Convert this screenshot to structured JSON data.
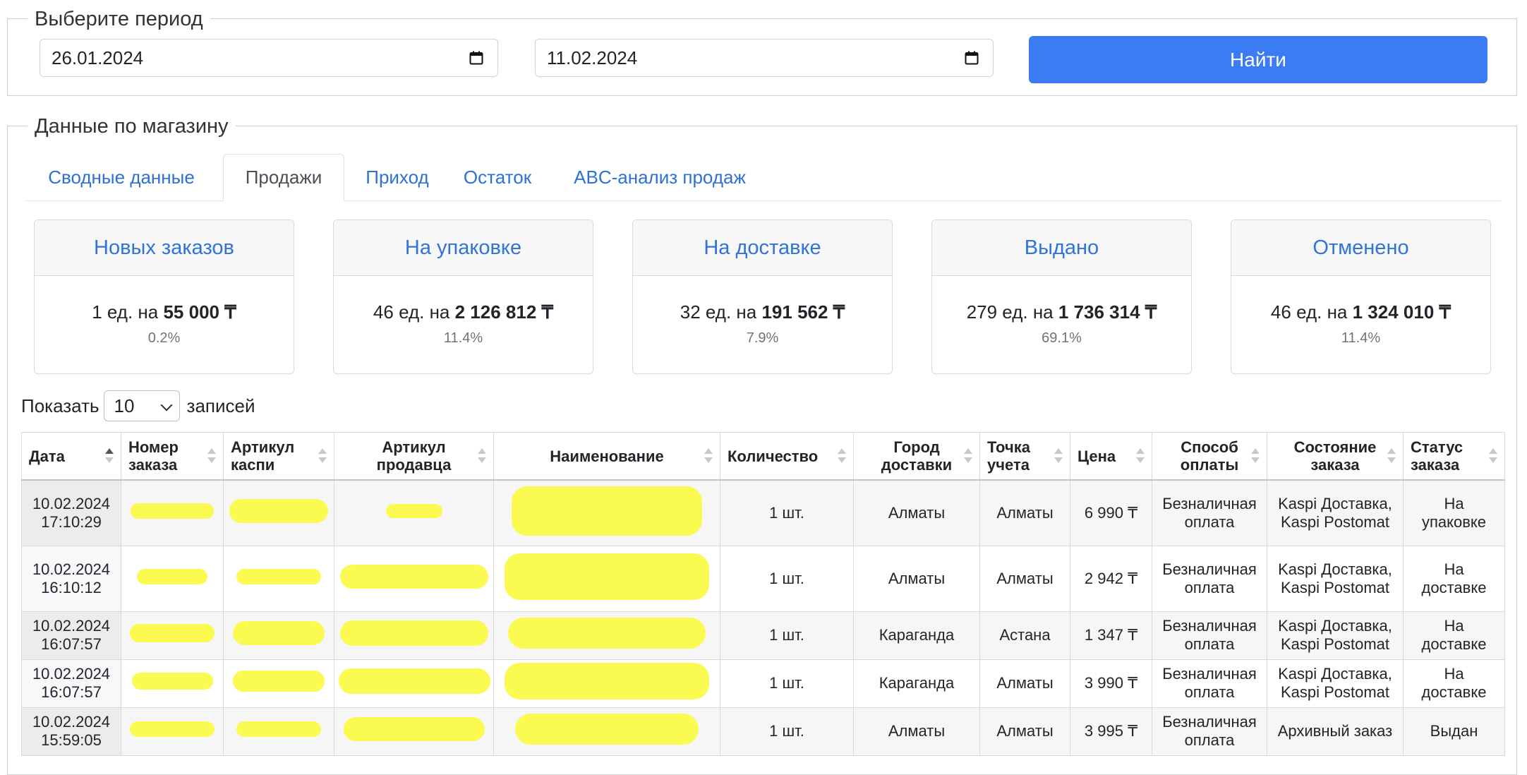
{
  "period": {
    "legend": "Выберите период",
    "date_from": "26.01.2024",
    "date_to": "11.02.2024",
    "find_label": "Найти"
  },
  "shop": {
    "legend": "Данные по магазину",
    "tabs": [
      {
        "label": "Сводные данные",
        "active": false
      },
      {
        "label": "Продажи",
        "active": true
      },
      {
        "label": "Приход",
        "active": false
      },
      {
        "label": "Остаток",
        "active": false
      },
      {
        "label": "ABC-анализ продаж",
        "active": false
      }
    ],
    "cards": [
      {
        "title": "Новых заказов",
        "qty": "1 ед. на ",
        "amount": "55 000 ₸",
        "pct": "0.2%"
      },
      {
        "title": "На упаковке",
        "qty": "46 ед. на ",
        "amount": "2 126 812 ₸",
        "pct": "11.4%"
      },
      {
        "title": "На доставке",
        "qty": "32 ед. на ",
        "amount": "191 562 ₸",
        "pct": "7.9%"
      },
      {
        "title": "Выдано",
        "qty": "279 ед. на ",
        "amount": "1 736 314 ₸",
        "pct": "69.1%"
      },
      {
        "title": "Отменено",
        "qty": "46 ед. на ",
        "amount": "1 324 010 ₸",
        "pct": "11.4%"
      }
    ]
  },
  "length_control": {
    "show": "Показать",
    "value": "10",
    "records": "записей"
  },
  "table": {
    "headers": [
      [
        "Дата"
      ],
      [
        "Номер",
        "заказа"
      ],
      [
        "Артикул",
        "каспи"
      ],
      [
        "Артикул",
        "продавца"
      ],
      [
        "Наименование"
      ],
      [
        "Количество"
      ],
      [
        "Город",
        "доставки"
      ],
      [
        "Точка",
        "учета"
      ],
      [
        "Цена"
      ],
      [
        "Способ",
        "оплаты"
      ],
      [
        "Состояние",
        "заказа"
      ],
      [
        "Статус",
        "заказа"
      ]
    ],
    "rows": [
      {
        "date": "10.02.2024",
        "time": "17:10:29",
        "qty": "1 шт.",
        "city": "Алматы",
        "point": "Алматы",
        "price": "6 990 ₸",
        "pay1": "Безналичная",
        "pay2": "оплата",
        "state1": "Kaspi Доставка,",
        "state2": "Kaspi Postomat",
        "status1": "На",
        "status2": "упаковке"
      },
      {
        "date": "10.02.2024",
        "time": "16:10:12",
        "qty": "1 шт.",
        "city": "Алматы",
        "point": "Алматы",
        "price": "2 942 ₸",
        "pay1": "Безналичная",
        "pay2": "оплата",
        "state1": "Kaspi Доставка,",
        "state2": "Kaspi Postomat",
        "status1": "На",
        "status2": "доставке"
      },
      {
        "date": "10.02.2024",
        "time": "16:07:57",
        "qty": "1 шт.",
        "city": "Караганда",
        "point": "Астана",
        "price": "1 347 ₸",
        "pay1": "Безналичная",
        "pay2": "оплата",
        "state1": "Kaspi Доставка,",
        "state2": "Kaspi Postomat",
        "status1": "На",
        "status2": "доставке"
      },
      {
        "date": "10.02.2024",
        "time": "16:07:57",
        "qty": "1 шт.",
        "city": "Караганда",
        "point": "Алматы",
        "price": "3 990 ₸",
        "pay1": "Безналичная",
        "pay2": "оплата",
        "state1": "Kaspi Доставка,",
        "state2": "Kaspi Postomat",
        "status1": "На",
        "status2": "доставке"
      },
      {
        "date": "10.02.2024",
        "time": "15:59:05",
        "qty": "1 шт.",
        "city": "Алматы",
        "point": "Алматы",
        "price": "3 995 ₸",
        "pay1": "Безналичная",
        "pay2": "оплата",
        "state1": "Архивный заказ",
        "state2": "",
        "status1": "Выдан",
        "status2": ""
      }
    ]
  },
  "colors": {
    "accent": "#3b7cf4",
    "link": "#2f6fd8",
    "redaction": "#fbfa47"
  }
}
